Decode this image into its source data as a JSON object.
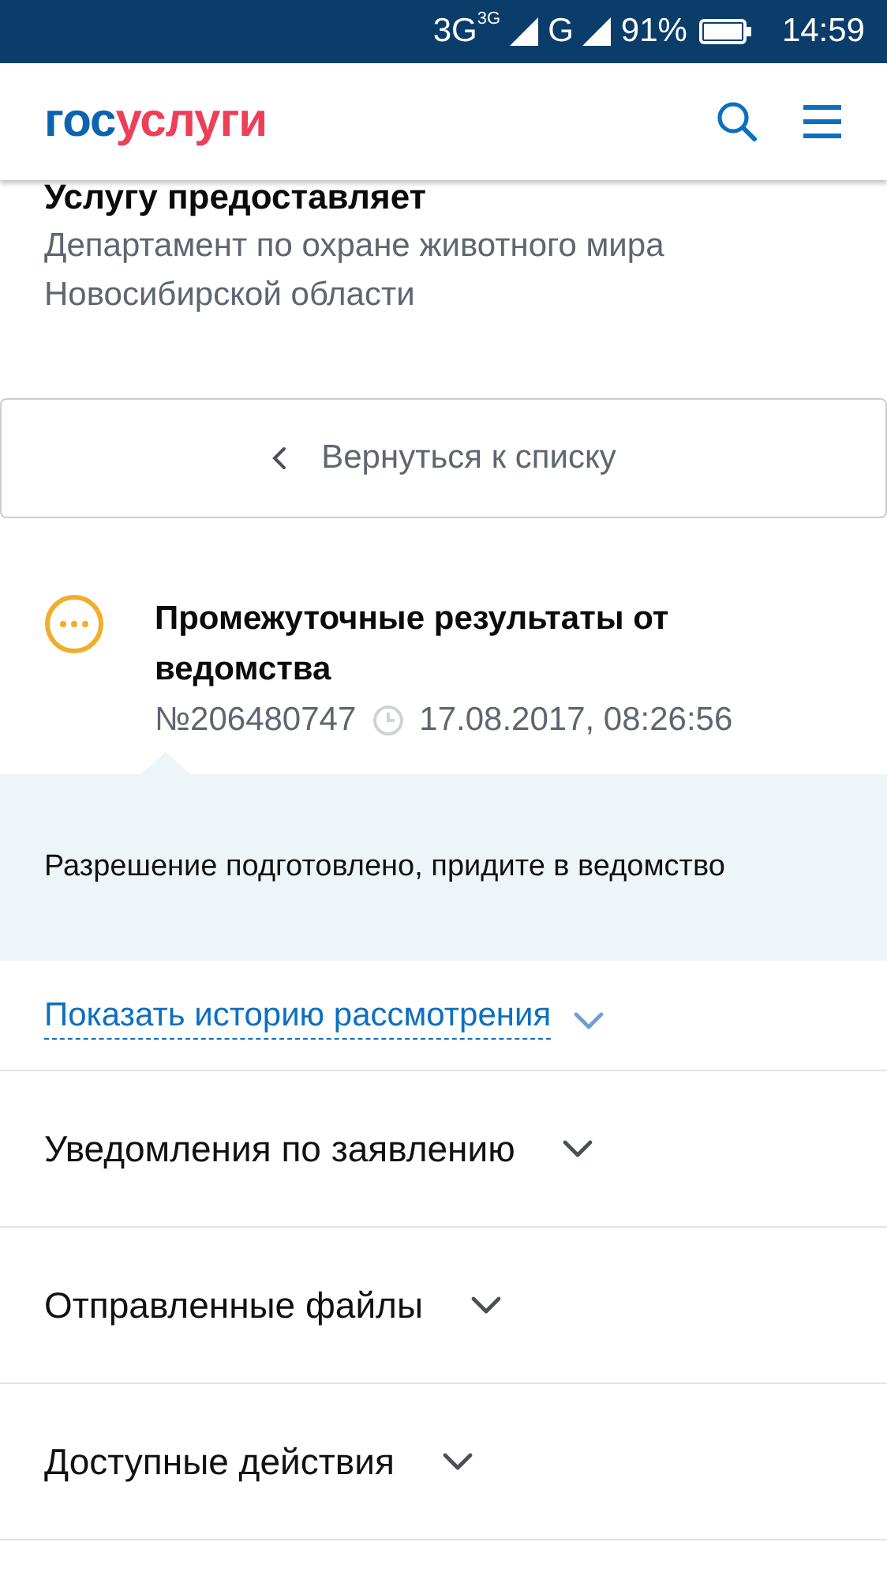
{
  "status_bar": {
    "network_1": "3G",
    "network_1_badge": "3G",
    "network_2": "G",
    "battery": "91%",
    "time": "14:59"
  },
  "header": {
    "logo_prefix": "гос",
    "logo_suffix": "услуги"
  },
  "provider": {
    "title": "Услугу предоставляет",
    "name": "Департамент по охране животного мира Новосибирской области"
  },
  "back_button": {
    "label": "Вернуться к списку"
  },
  "status": {
    "title": "Промежуточные результаты от ведомства",
    "number": "№206480747",
    "datetime": "17.08.2017, 08:26:56",
    "message": "Разрешение подготовлено, придите в ведомство"
  },
  "history_link": {
    "label": "Показать историю рассмотрения",
    "expanded": false
  },
  "sections": [
    {
      "label": "Уведомления по заявлению",
      "expanded": false
    },
    {
      "label": "Отправленные файлы",
      "expanded": false
    },
    {
      "label": "Доступные действия",
      "expanded": false
    }
  ]
}
